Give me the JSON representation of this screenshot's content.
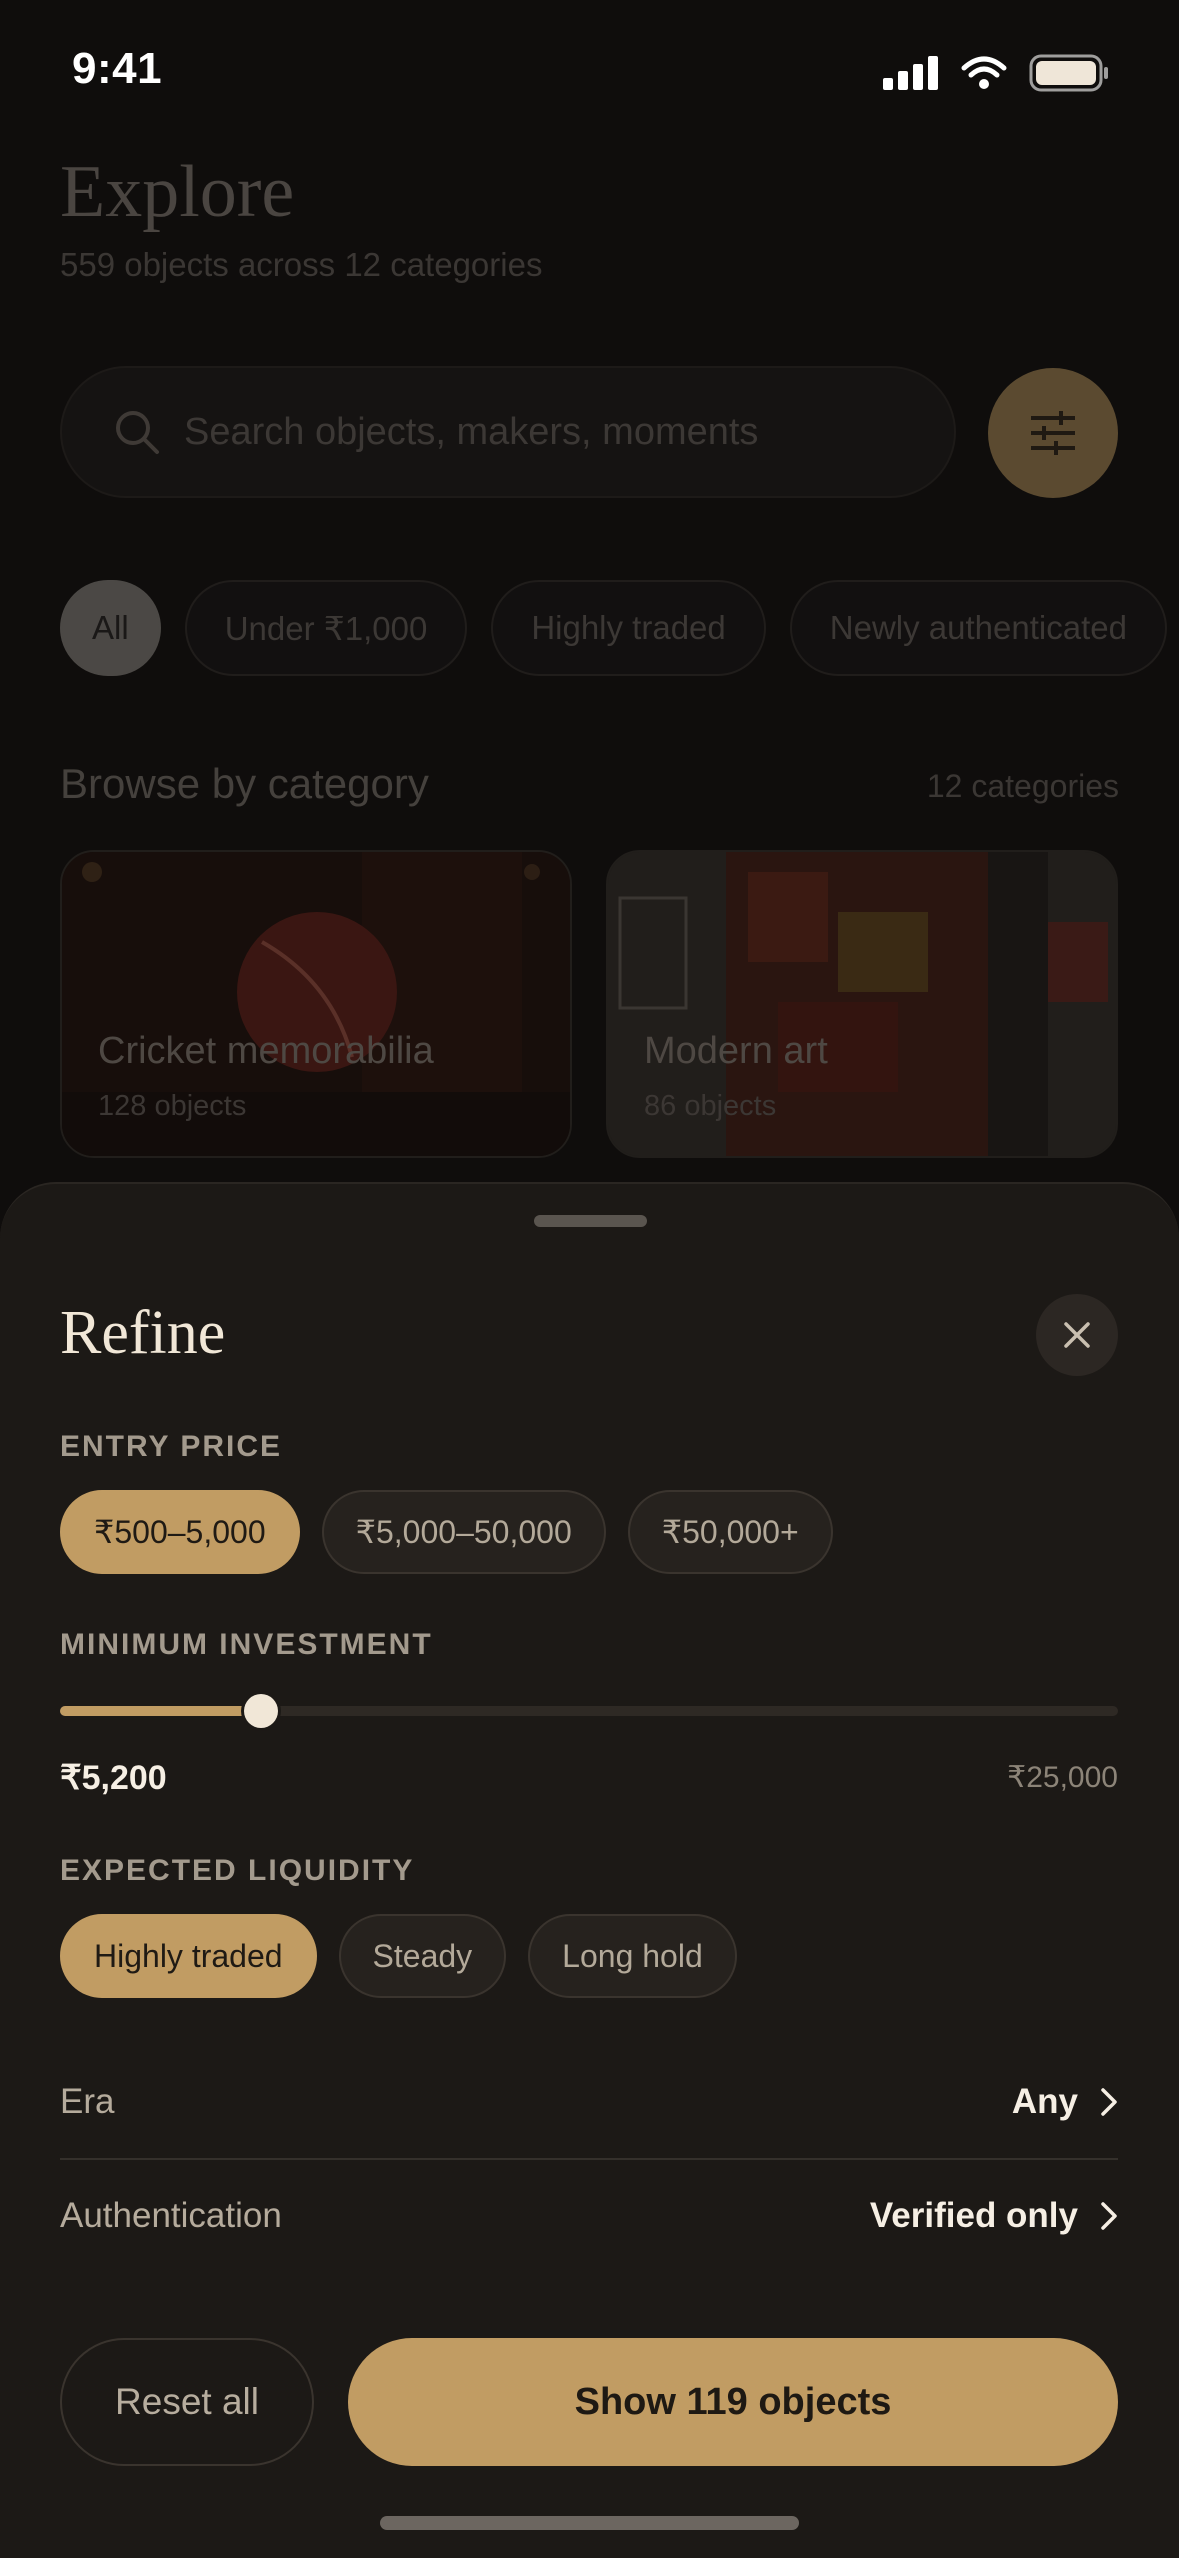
{
  "status": {
    "time": "9:41"
  },
  "explore": {
    "title": "Explore",
    "subtitle": "559 objects across 12 categories",
    "search_placeholder": "Search objects, makers, moments",
    "chips": [
      "All",
      "Under ₹1,000",
      "Highly traded",
      "Newly authenticated"
    ],
    "active_chip": "All",
    "browse_title": "Browse by category",
    "browse_count": "12 categories",
    "categories": [
      {
        "name": "Cricket memorabilia",
        "count": "128 objects"
      },
      {
        "name": "Modern art",
        "count": "86 objects"
      }
    ]
  },
  "refine": {
    "title": "Refine",
    "entry_price": {
      "label": "ENTRY PRICE",
      "options": [
        "₹500–5,000",
        "₹5,000–50,000",
        "₹50,000+"
      ],
      "selected": "₹500–5,000"
    },
    "min_investment": {
      "label": "MINIMUM INVESTMENT",
      "value": "₹5,200",
      "max": "₹25,000",
      "fill_fraction": 0.19
    },
    "liquidity": {
      "label": "EXPECTED LIQUIDITY",
      "options": [
        "Highly traded",
        "Steady",
        "Long hold"
      ],
      "selected": "Highly traded"
    },
    "era": {
      "label": "Era",
      "value": "Any"
    },
    "authentication": {
      "label": "Authentication",
      "value": "Verified only"
    },
    "reset_label": "Reset all",
    "show_label": "Show 119 objects"
  },
  "colors": {
    "accent": "#c19c63",
    "sheet": "#1c1916",
    "background": "#0f0d0c"
  }
}
